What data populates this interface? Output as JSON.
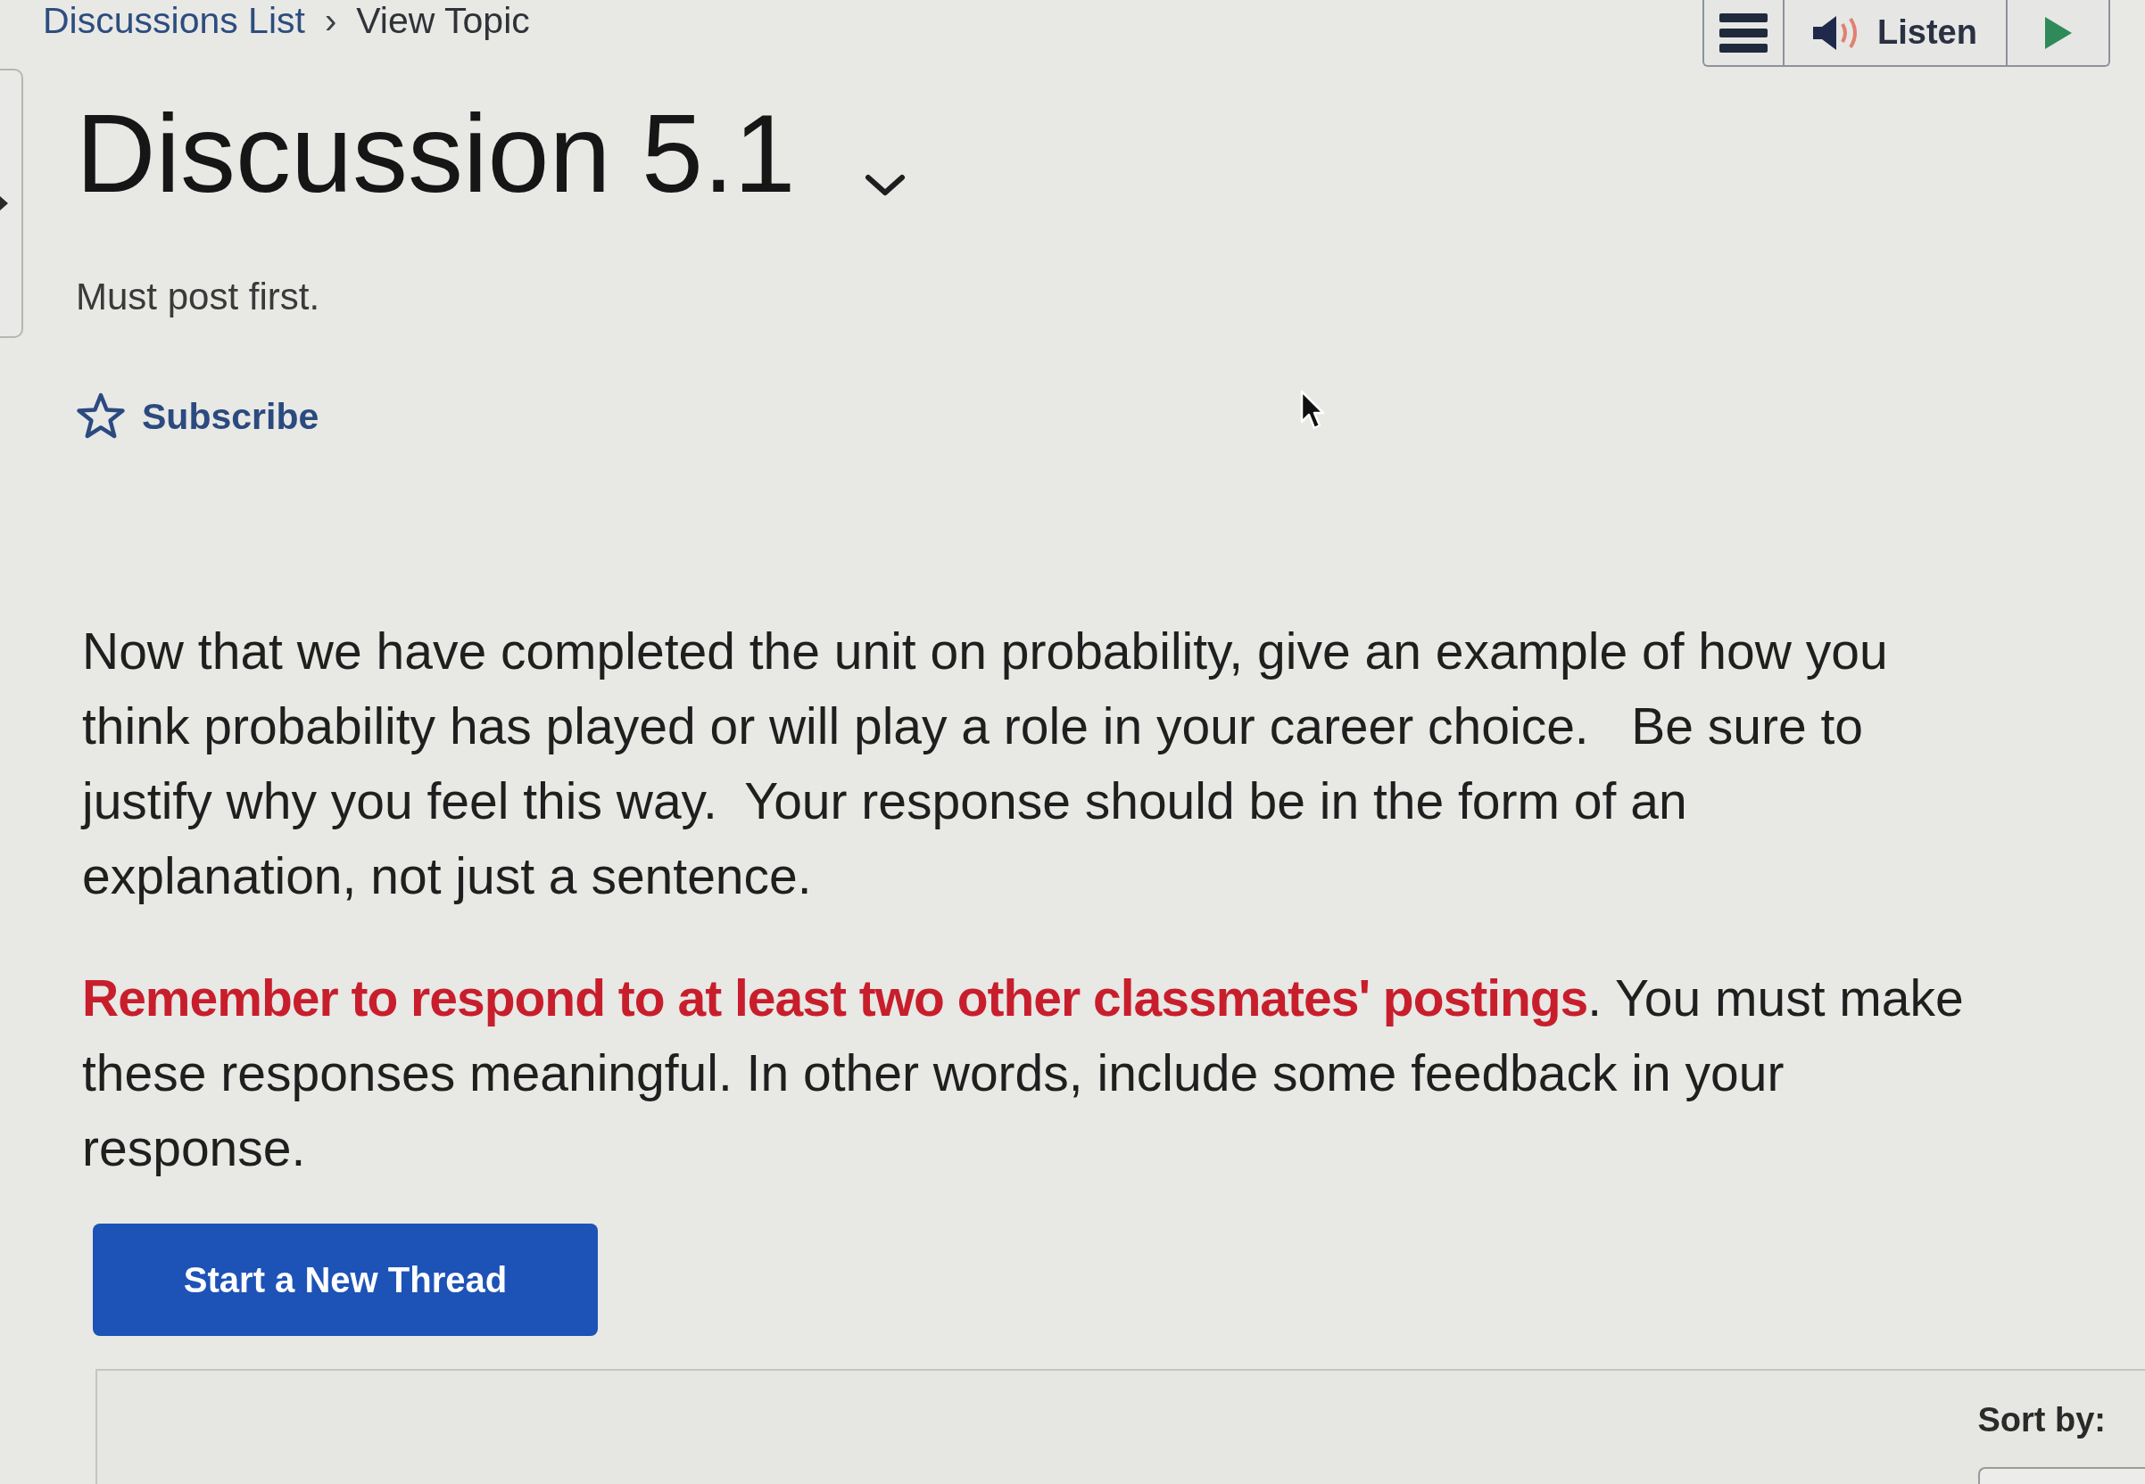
{
  "breadcrumb": {
    "items": [
      {
        "label": "Discussions List",
        "kind": "link"
      },
      {
        "label": "View Topic",
        "kind": "current"
      }
    ],
    "separator": "›"
  },
  "toolbar": {
    "listen_label": "Listen"
  },
  "title": "Discussion 5.1",
  "restriction": "Must post first.",
  "subscribe": {
    "label": "Subscribe",
    "subscribed": false
  },
  "instructions": "Now that we have completed the unit on probability, give an example of how you think probability has played or will play a role in your career choice.   Be sure to justify why you feel this way.  Your response should be in the form of an explanation, not just a sentence.",
  "reminder": {
    "emphasis": "Remember to respond to at least two other classmates' postings",
    "text": ". You must make these responses meaningful. In other words, include some feedback in your response."
  },
  "new_thread_button": "Start a New Thread",
  "sort": {
    "label": "Sort by:"
  }
}
